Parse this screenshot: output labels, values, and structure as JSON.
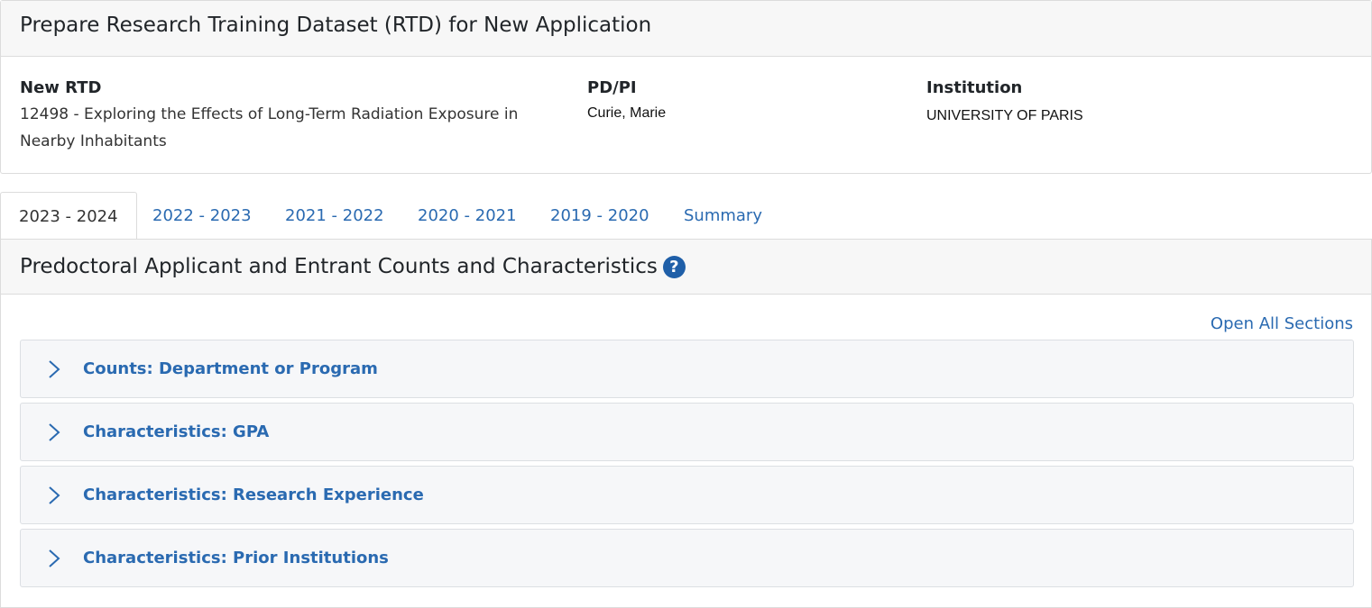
{
  "header": {
    "title": "Prepare Research Training Dataset (RTD) for New Application"
  },
  "info": {
    "rtd_label": "New RTD",
    "rtd_value": "12498 - Exploring the Effects of Long-Term Radiation Exposure in Nearby Inhabitants",
    "pdpi_label": "PD/PI",
    "pdpi_value": "Curie, Marie",
    "institution_label": "Institution",
    "institution_value": "UNIVERSITY OF PARIS"
  },
  "tabs": [
    {
      "label": "2023 - 2024",
      "active": true
    },
    {
      "label": "2022 - 2023",
      "active": false
    },
    {
      "label": "2021 - 2022",
      "active": false
    },
    {
      "label": "2020 - 2021",
      "active": false
    },
    {
      "label": "2019 - 2020",
      "active": false
    },
    {
      "label": "Summary",
      "active": false
    }
  ],
  "section": {
    "title": "Predoctoral Applicant and Entrant Counts and Characteristics",
    "help_icon": "question-circle-icon",
    "open_all_label": "Open All Sections",
    "accordions": [
      {
        "label": "Counts: Department or Program"
      },
      {
        "label": "Characteristics: GPA"
      },
      {
        "label": "Characteristics: Research Experience"
      },
      {
        "label": "Characteristics: Prior Institutions"
      }
    ]
  },
  "colors": {
    "link": "#2a6ab1",
    "help_icon": "#1f5fa8",
    "header_bg": "#f7f7f7",
    "accordion_bg": "#f6f7f9"
  }
}
